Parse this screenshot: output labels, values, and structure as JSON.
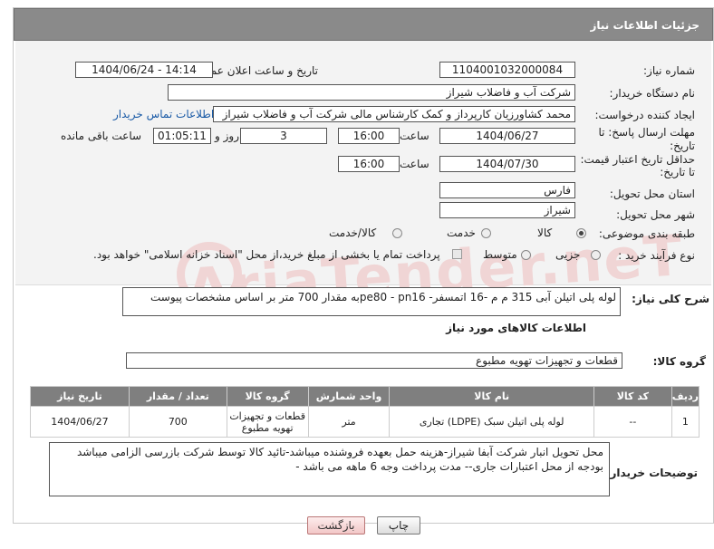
{
  "header": {
    "title": "جزئیات اطلاعات نیاز"
  },
  "form": {
    "need_number_label": "شماره نیاز:",
    "need_number": "1104001032000084",
    "announce_label": "تاریخ و ساعت اعلان عمومی:",
    "announce_value": "1404/06/24 - 14:14",
    "buyer_org_label": "نام دستگاه خریدار:",
    "buyer_org": "شرکت آب و فاضلاب شیراز",
    "creator_label": "ایجاد کننده درخواست:",
    "creator": "محمد کشاورزیان کارپرداز و کمک کارشناس مالی شرکت آب و فاضلاب شیراز",
    "contact_link": "اطلاعات تماس خریدار",
    "deadline_label_1": "مهلت ارسال پاسخ: تا",
    "deadline_label_2": "تاریخ:",
    "deadline_date": "1404/06/27",
    "time_label": "ساعت",
    "deadline_time": "16:00",
    "days_value": "3",
    "days_label": "روز و",
    "remaining_time": "01:05:11",
    "remaining_label": "ساعت باقی مانده",
    "validity_label_1": "حداقل تاریخ اعتبار قیمت:",
    "validity_label_2": "تا تاریخ:",
    "validity_date": "1404/07/30",
    "validity_time": "16:00",
    "province_label": "استان محل تحویل:",
    "province": "فارس",
    "city_label": "شهر محل تحویل:",
    "city": "شیراز",
    "category_label": "طبقه بندی موضوعی:",
    "category_options": [
      "کالا",
      "خدمت",
      "کالا/خدمت"
    ],
    "category_selected": "کالا",
    "purchase_label": "نوع فرآیند خرید :",
    "purchase_options": [
      "جزیی",
      "متوسط"
    ],
    "purchase_selected": "جزیی",
    "payment_note": "پرداخت تمام یا بخشی از مبلغ خرید،از محل \"اسناد خزانه اسلامی\" خواهد بود."
  },
  "description": {
    "label": "شرح کلی نیاز:",
    "text": "لوله پلی اتیلن آبی 315 م م -16 اتمسفر- pe80 - pn16به مقدار 700 متر بر اساس مشخصات پیوست"
  },
  "items_section": {
    "title": "اطلاعات کالاهای مورد نیاز",
    "group_label": "گروه کالا:",
    "group_value": "قطعات و تجهیزات تهویه مطبوع",
    "columns": [
      "ردیف",
      "کد کالا",
      "نام کالا",
      "واحد شمارش",
      "گروه کالا",
      "تعداد / مقدار",
      "تاریخ نیاز"
    ],
    "rows": [
      [
        "1",
        "--",
        "لوله پلی اتیلن سبک (LDPE) تجاری",
        "متر",
        "قطعات و تجهیزات تهویه مطبوع",
        "700",
        "1404/06/27"
      ]
    ]
  },
  "buyer_notes": {
    "label": "توضیحات خریدار:",
    "line1": "محل تحویل انبار شرکت آبفا شیراز-هزینه حمل بعهده فروشنده میباشد-تائید کالا توسط شرکت بازرسی الزامی میباشد",
    "line2": "بودجه از محل اعتبارات جاری-- مدت پرداخت وجه  6 ماهه می باشد -"
  },
  "buttons": {
    "print": "چاپ",
    "back": "بازگشت"
  },
  "watermark": "AriaTender.neT"
}
